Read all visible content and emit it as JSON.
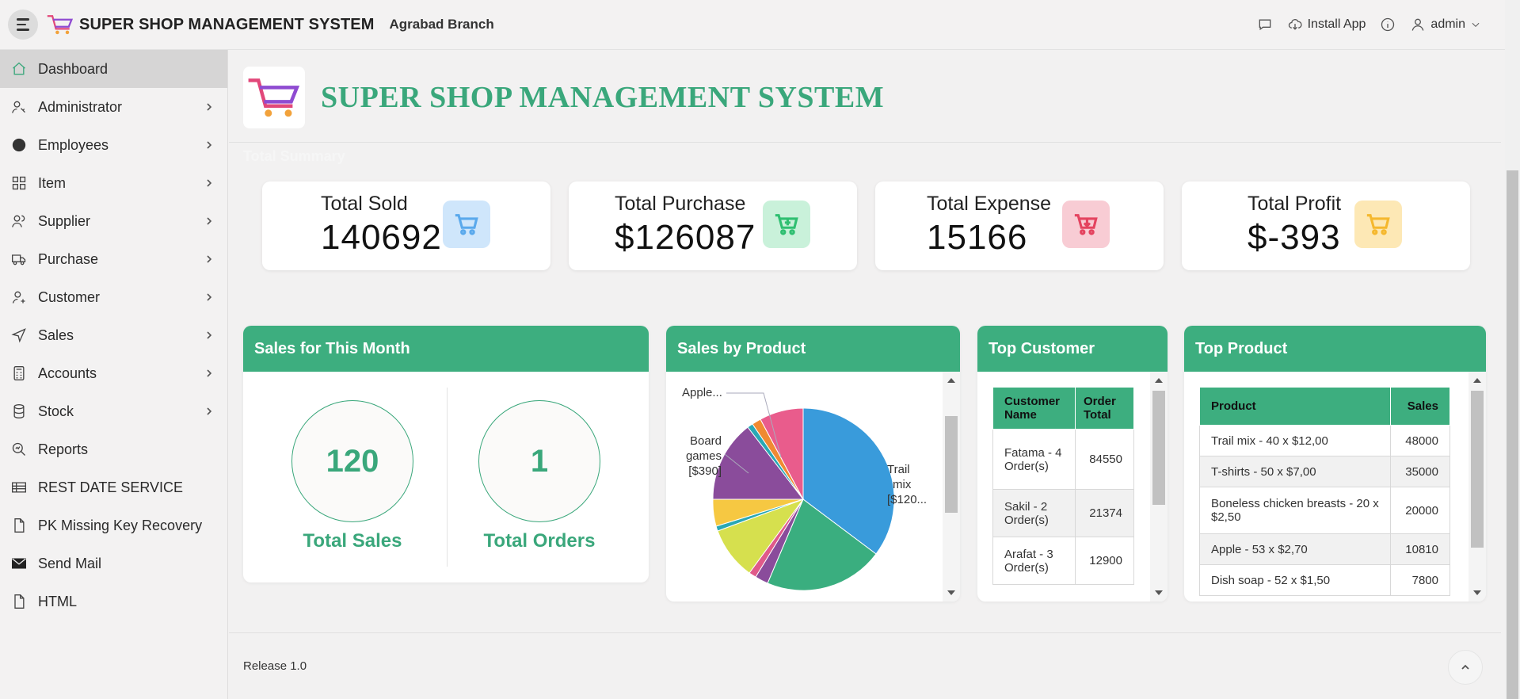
{
  "header": {
    "app_title": "SUPER SHOP MANAGEMENT SYSTEM",
    "branch": "Agrabad Branch",
    "install_label": "Install App",
    "user_label": "admin"
  },
  "sidebar": {
    "items": [
      {
        "label": "Dashboard",
        "icon": "home-icon",
        "active": true
      },
      {
        "label": "Administrator",
        "icon": "user-key-icon"
      },
      {
        "label": "Employees",
        "icon": "user-circle-icon"
      },
      {
        "label": "Item",
        "icon": "grid-icon"
      },
      {
        "label": "Supplier",
        "icon": "users-icon"
      },
      {
        "label": "Purchase",
        "icon": "truck-icon"
      },
      {
        "label": "Customer",
        "icon": "user-gear-icon"
      },
      {
        "label": "Sales",
        "icon": "send-icon"
      },
      {
        "label": "Accounts",
        "icon": "calculator-icon"
      },
      {
        "label": "Stock",
        "icon": "database-icon"
      },
      {
        "label": "Reports",
        "icon": "search-report-icon"
      },
      {
        "label": "REST DATE SERVICE",
        "icon": "table-icon"
      },
      {
        "label": "PK Missing Key Recovery",
        "icon": "file-icon"
      },
      {
        "label": "Send Mail",
        "icon": "mail-icon"
      },
      {
        "label": "HTML",
        "icon": "file-icon"
      }
    ]
  },
  "main": {
    "hero_title": "SUPER SHOP MANAGEMENT SYSTEM",
    "summary_label": "Total Summary",
    "cards": [
      {
        "label": "Total Sold",
        "value": "140692",
        "color": "#5aa9ec",
        "bg": "#cfe6fb"
      },
      {
        "label": "Total Purchase",
        "value": "$126087",
        "color": "#2fbf71",
        "bg": "#c9f1da"
      },
      {
        "label": "Total Expense",
        "value": "15166",
        "color": "#e4435f",
        "bg": "#f8ccd4"
      },
      {
        "label": "Total Profit",
        "value": "$-393",
        "color": "#f5b82e",
        "bg": "#fde8b5"
      }
    ],
    "sales_month": {
      "title": "Sales for This Month",
      "total_sales_value": "120",
      "total_sales_label": "Total Sales",
      "total_orders_value": "1",
      "total_orders_label": "Total Orders"
    },
    "sales_by_product": {
      "title": "Sales by Product",
      "labels": {
        "apple": "Apple...",
        "board_games_line1": "Board",
        "board_games_line2": "games",
        "board_games_line3": "[$390]",
        "trail_mix_line1": "Trail",
        "trail_mix_line2": "mix",
        "trail_mix_line3": "[$120..."
      }
    },
    "top_customer": {
      "title": "Top Customer",
      "headers": [
        "Customer Name",
        "Order Total"
      ],
      "rows": [
        {
          "name": "Fatama - 4 Order(s)",
          "total": "84550"
        },
        {
          "name": "Sakil - 2 Order(s)",
          "total": "21374"
        },
        {
          "name": "Arafat - 3 Order(s)",
          "total": "12900"
        }
      ]
    },
    "top_product": {
      "title": "Top Product",
      "headers": [
        "Product",
        "Sales"
      ],
      "rows": [
        {
          "product": "Trail mix - 40 x $12,00",
          "sales": "48000"
        },
        {
          "product": "T-shirts - 50 x $7,00",
          "sales": "35000"
        },
        {
          "product": "Boneless chicken breasts - 20 x $2,50",
          "sales": "20000"
        },
        {
          "product": "Apple - 53 x $2,70",
          "sales": "10810"
        },
        {
          "product": "Dish soap - 52 x $1,50",
          "sales": "7800"
        }
      ]
    },
    "footer": {
      "release": "Release 1.0"
    }
  }
}
